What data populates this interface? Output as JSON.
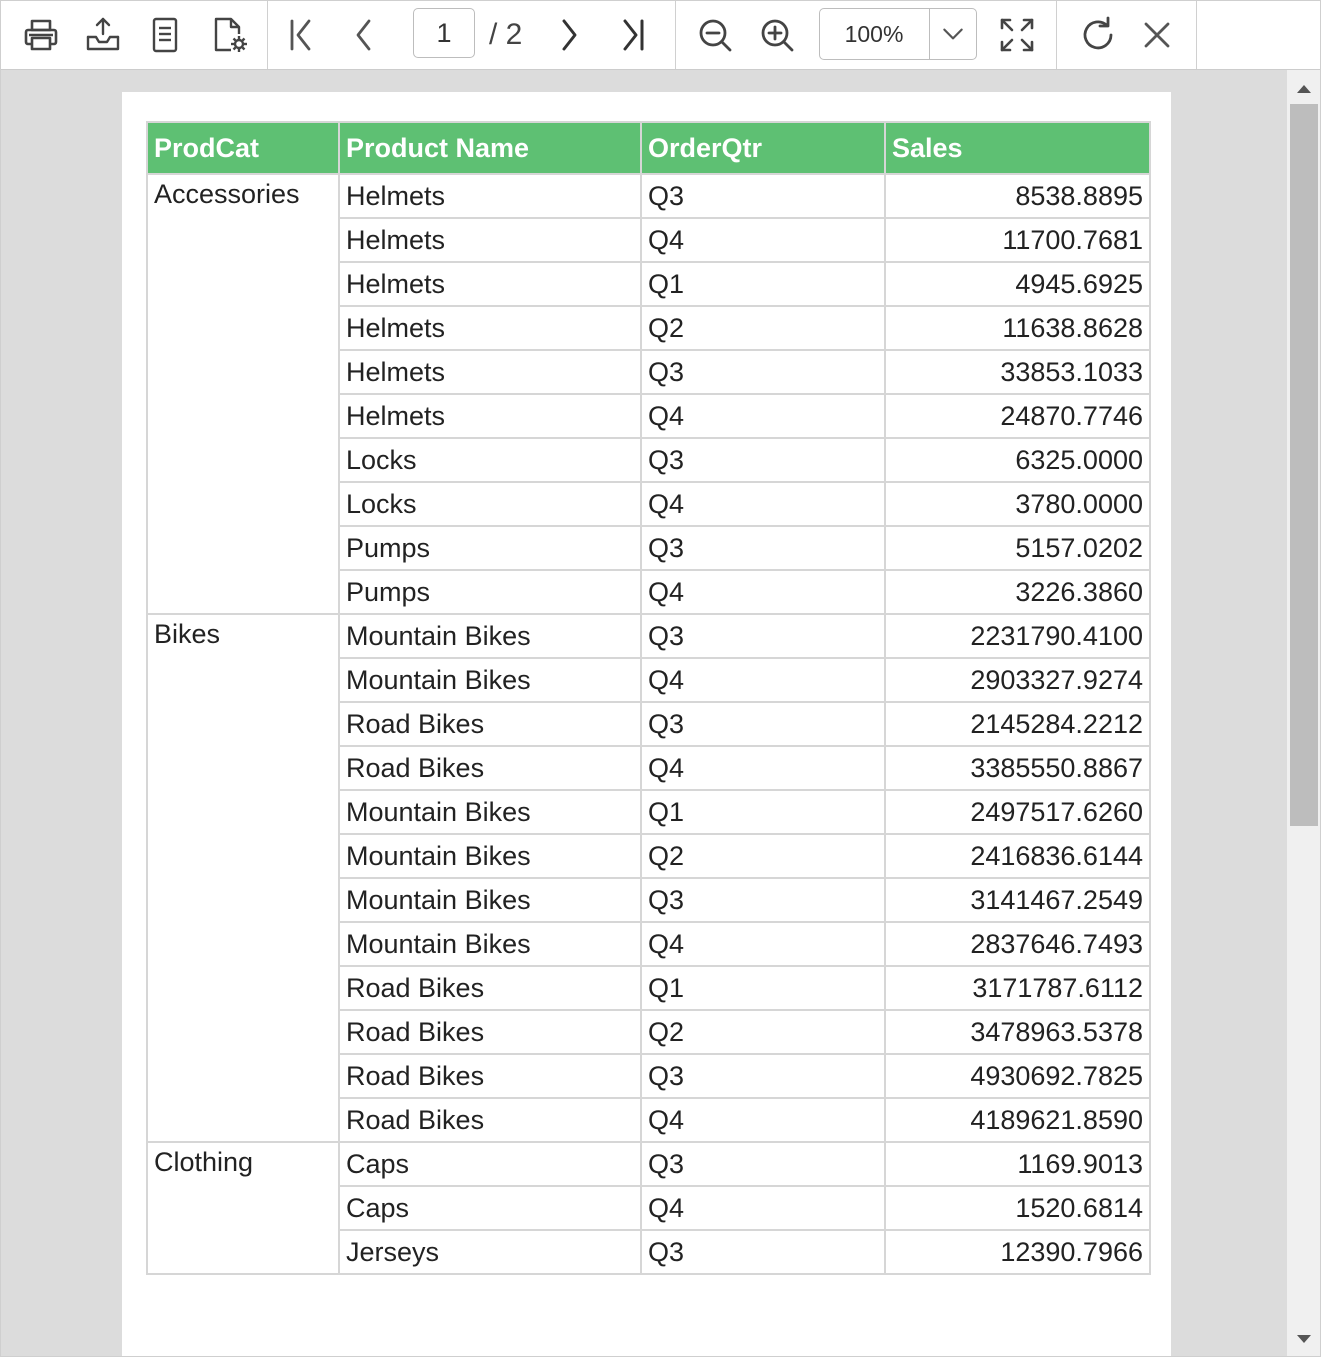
{
  "toolbar": {
    "current_page": "1",
    "total_pages": "/ 2",
    "zoom_value": "100%",
    "icons": [
      "print-icon",
      "export-icon",
      "page-setup-icon",
      "settings-page-icon",
      "first-page-icon",
      "previous-page-icon",
      "next-page-icon",
      "last-page-icon",
      "zoom-out-icon",
      "zoom-in-icon",
      "fit-page-icon",
      "refresh-icon",
      "close-icon"
    ]
  },
  "colors": {
    "header_bg": "#5ec073",
    "header_text": "#ffffff",
    "grid_line": "#d6d6d6",
    "viewer_bg": "#dcdcdc"
  },
  "report": {
    "columns": [
      "ProdCat",
      "Product Name",
      "OrderQtr",
      "Sales"
    ],
    "groups": [
      {
        "category": "Accessories",
        "rows": [
          [
            "Helmets",
            "Q3",
            "8538.8895"
          ],
          [
            "Helmets",
            "Q4",
            "11700.7681"
          ],
          [
            "Helmets",
            "Q1",
            "4945.6925"
          ],
          [
            "Helmets",
            "Q2",
            "11638.8628"
          ],
          [
            "Helmets",
            "Q3",
            "33853.1033"
          ],
          [
            "Helmets",
            "Q4",
            "24870.7746"
          ],
          [
            "Locks",
            "Q3",
            "6325.0000"
          ],
          [
            "Locks",
            "Q4",
            "3780.0000"
          ],
          [
            "Pumps",
            "Q3",
            "5157.0202"
          ],
          [
            "Pumps",
            "Q4",
            "3226.3860"
          ]
        ]
      },
      {
        "category": "Bikes",
        "rows": [
          [
            "Mountain Bikes",
            "Q3",
            "2231790.4100"
          ],
          [
            "Mountain Bikes",
            "Q4",
            "2903327.9274"
          ],
          [
            "Road Bikes",
            "Q3",
            "2145284.2212"
          ],
          [
            "Road Bikes",
            "Q4",
            "3385550.8867"
          ],
          [
            "Mountain Bikes",
            "Q1",
            "2497517.6260"
          ],
          [
            "Mountain Bikes",
            "Q2",
            "2416836.6144"
          ],
          [
            "Mountain Bikes",
            "Q3",
            "3141467.2549"
          ],
          [
            "Mountain Bikes",
            "Q4",
            "2837646.7493"
          ],
          [
            "Road Bikes",
            "Q1",
            "3171787.6112"
          ],
          [
            "Road Bikes",
            "Q2",
            "3478963.5378"
          ],
          [
            "Road Bikes",
            "Q3",
            "4930692.7825"
          ],
          [
            "Road Bikes",
            "Q4",
            "4189621.8590"
          ]
        ]
      },
      {
        "category": "Clothing",
        "rows": [
          [
            "Caps",
            "Q3",
            "1169.9013"
          ],
          [
            "Caps",
            "Q4",
            "1520.6814"
          ],
          [
            "Jerseys",
            "Q3",
            "12390.7966"
          ]
        ]
      }
    ]
  }
}
